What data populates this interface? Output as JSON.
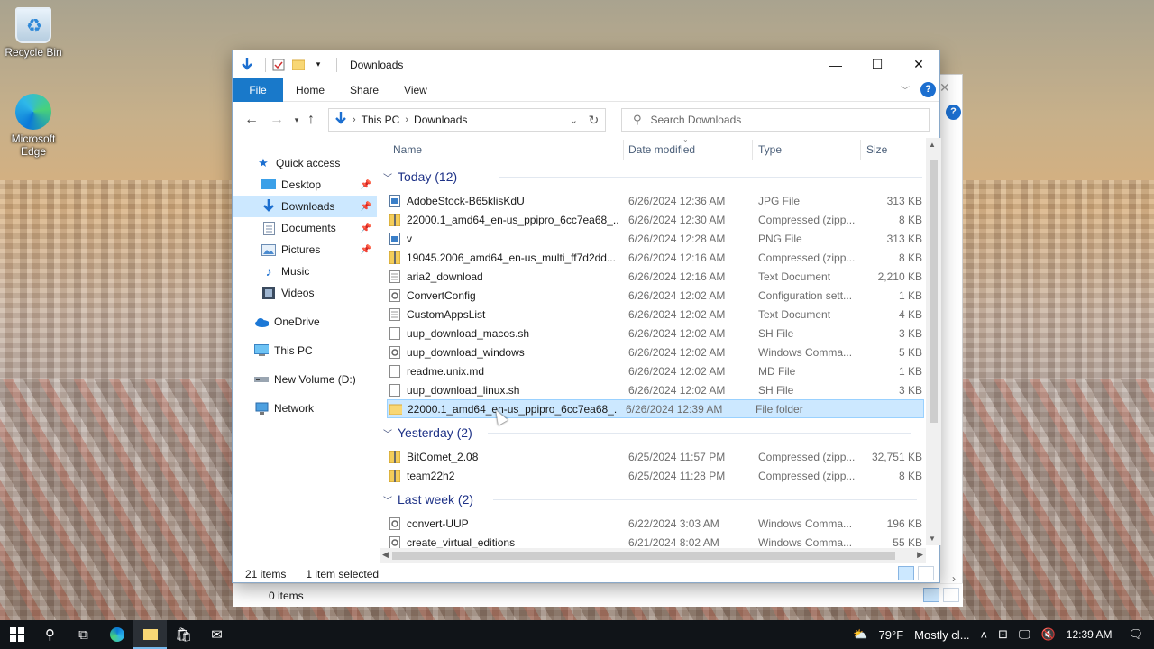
{
  "desktop": {
    "icons": [
      {
        "label": "Recycle Bin"
      },
      {
        "label": "Microsoft Edge"
      }
    ]
  },
  "window": {
    "title": "Downloads",
    "ribbon_tabs": [
      "File",
      "Home",
      "Share",
      "View"
    ],
    "address": {
      "crumbs": [
        "This PC",
        "Downloads"
      ]
    },
    "search": {
      "placeholder": "Search Downloads"
    },
    "sidebar": [
      {
        "label": "Quick access",
        "icon": "star-icon",
        "pinned": false
      },
      {
        "label": "Desktop",
        "icon": "desktop-icon",
        "pinned": true
      },
      {
        "label": "Downloads",
        "icon": "download-icon",
        "pinned": true,
        "selected": true
      },
      {
        "label": "Documents",
        "icon": "documents-icon",
        "pinned": true
      },
      {
        "label": "Pictures",
        "icon": "pictures-icon",
        "pinned": true
      },
      {
        "label": "Music",
        "icon": "music-icon",
        "pinned": false
      },
      {
        "label": "Videos",
        "icon": "videos-icon",
        "pinned": false
      },
      {
        "label": "OneDrive",
        "icon": "cloud-icon",
        "pinned": false
      },
      {
        "label": "This PC",
        "icon": "computer-icon",
        "pinned": false
      },
      {
        "label": "New Volume (D:)",
        "icon": "drive-icon",
        "pinned": false
      },
      {
        "label": "Network",
        "icon": "network-icon",
        "pinned": false
      }
    ],
    "columns": [
      "Name",
      "Date modified",
      "Type",
      "Size"
    ],
    "groups": [
      {
        "label": "Today (12)",
        "files": [
          {
            "name": "AdobeStock-B65klisKdU",
            "date": "6/26/2024 12:36 AM",
            "type": "JPG File",
            "size": "313 KB",
            "icon": "image-icon"
          },
          {
            "name": "22000.1_amd64_en-us_ppipro_6cc7ea68_...",
            "date": "6/26/2024 12:30 AM",
            "type": "Compressed (zipp...",
            "size": "8 KB",
            "icon": "zip-icon"
          },
          {
            "name": "v",
            "date": "6/26/2024 12:28 AM",
            "type": "PNG File",
            "size": "313 KB",
            "icon": "image-icon"
          },
          {
            "name": "19045.2006_amd64_en-us_multi_ff7d2dd...",
            "date": "6/26/2024 12:16 AM",
            "type": "Compressed (zipp...",
            "size": "8 KB",
            "icon": "zip-icon"
          },
          {
            "name": "aria2_download",
            "date": "6/26/2024 12:16 AM",
            "type": "Text Document",
            "size": "2,210 KB",
            "icon": "text-file-icon"
          },
          {
            "name": "ConvertConfig",
            "date": "6/26/2024 12:02 AM",
            "type": "Configuration sett...",
            "size": "1 KB",
            "icon": "config-icon"
          },
          {
            "name": "CustomAppsList",
            "date": "6/26/2024 12:02 AM",
            "type": "Text Document",
            "size": "4 KB",
            "icon": "text-file-icon"
          },
          {
            "name": "uup_download_macos.sh",
            "date": "6/26/2024 12:02 AM",
            "type": "SH File",
            "size": "3 KB",
            "icon": "file-icon"
          },
          {
            "name": "uup_download_windows",
            "date": "6/26/2024 12:02 AM",
            "type": "Windows Comma...",
            "size": "5 KB",
            "icon": "cmd-icon"
          },
          {
            "name": "readme.unix.md",
            "date": "6/26/2024 12:02 AM",
            "type": "MD File",
            "size": "1 KB",
            "icon": "file-icon"
          },
          {
            "name": "uup_download_linux.sh",
            "date": "6/26/2024 12:02 AM",
            "type": "SH File",
            "size": "3 KB",
            "icon": "file-icon"
          },
          {
            "name": "22000.1_amd64_en-us_ppipro_6cc7ea68_...",
            "date": "6/26/2024 12:39 AM",
            "type": "File folder",
            "size": "",
            "icon": "folder-icon",
            "selected": true
          }
        ]
      },
      {
        "label": "Yesterday (2)",
        "files": [
          {
            "name": "BitComet_2.08",
            "date": "6/25/2024 11:57 PM",
            "type": "Compressed (zipp...",
            "size": "32,751 KB",
            "icon": "zip-icon"
          },
          {
            "name": "team22h2",
            "date": "6/25/2024 11:28 PM",
            "type": "Compressed (zipp...",
            "size": "8 KB",
            "icon": "zip-icon"
          }
        ]
      },
      {
        "label": "Last week (2)",
        "files": [
          {
            "name": "convert-UUP",
            "date": "6/22/2024 3:03 AM",
            "type": "Windows Comma...",
            "size": "196 KB",
            "icon": "cmd-icon"
          },
          {
            "name": "create_virtual_editions",
            "date": "6/21/2024 8:02 AM",
            "type": "Windows Comma...",
            "size": "55 KB",
            "icon": "cmd-icon"
          }
        ]
      }
    ],
    "status": {
      "items": "21 items",
      "selected": "1 item selected"
    }
  },
  "back_window": {
    "status_text": "0 items"
  },
  "taskbar": {
    "weather_temp": "79°F",
    "weather_text": "Mostly cl...",
    "time": "12:39 AM"
  },
  "colors": {
    "accent": "#1979ca",
    "selection": "#cce8ff",
    "group_header": "#1e3287"
  }
}
